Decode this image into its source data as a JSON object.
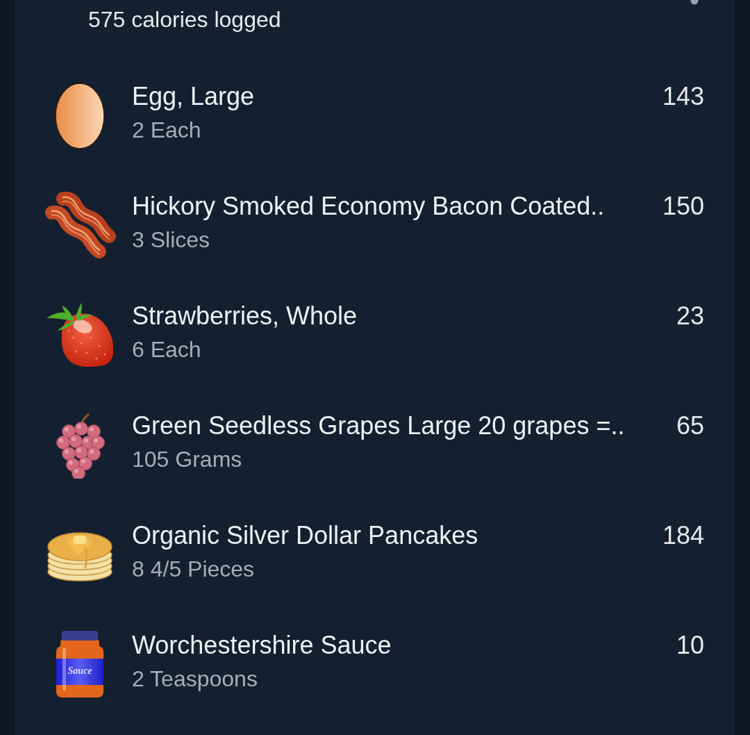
{
  "summary": {
    "text": "575 calories logged"
  },
  "entries": [
    {
      "kind": "egg",
      "name": "Egg, Large",
      "serving": "2 Each",
      "calories": "143"
    },
    {
      "kind": "bacon",
      "name": "Hickory Smoked Economy Bacon Coated..",
      "serving": "3 Slices",
      "calories": "150"
    },
    {
      "kind": "strawberry",
      "name": "Strawberries, Whole",
      "serving": "6 Each",
      "calories": "23"
    },
    {
      "kind": "grapes",
      "name": "Green Seedless Grapes Large 20 grapes =..",
      "serving": "105 Grams",
      "calories": "65"
    },
    {
      "kind": "pancakes",
      "name": "Organic Silver Dollar Pancakes",
      "serving": "8 4/5 Pieces",
      "calories": "184"
    },
    {
      "kind": "jar",
      "name": "Worchestershire Sauce",
      "serving": "2 Teaspoons",
      "calories": "10",
      "icon_text": "Sauce"
    }
  ]
}
